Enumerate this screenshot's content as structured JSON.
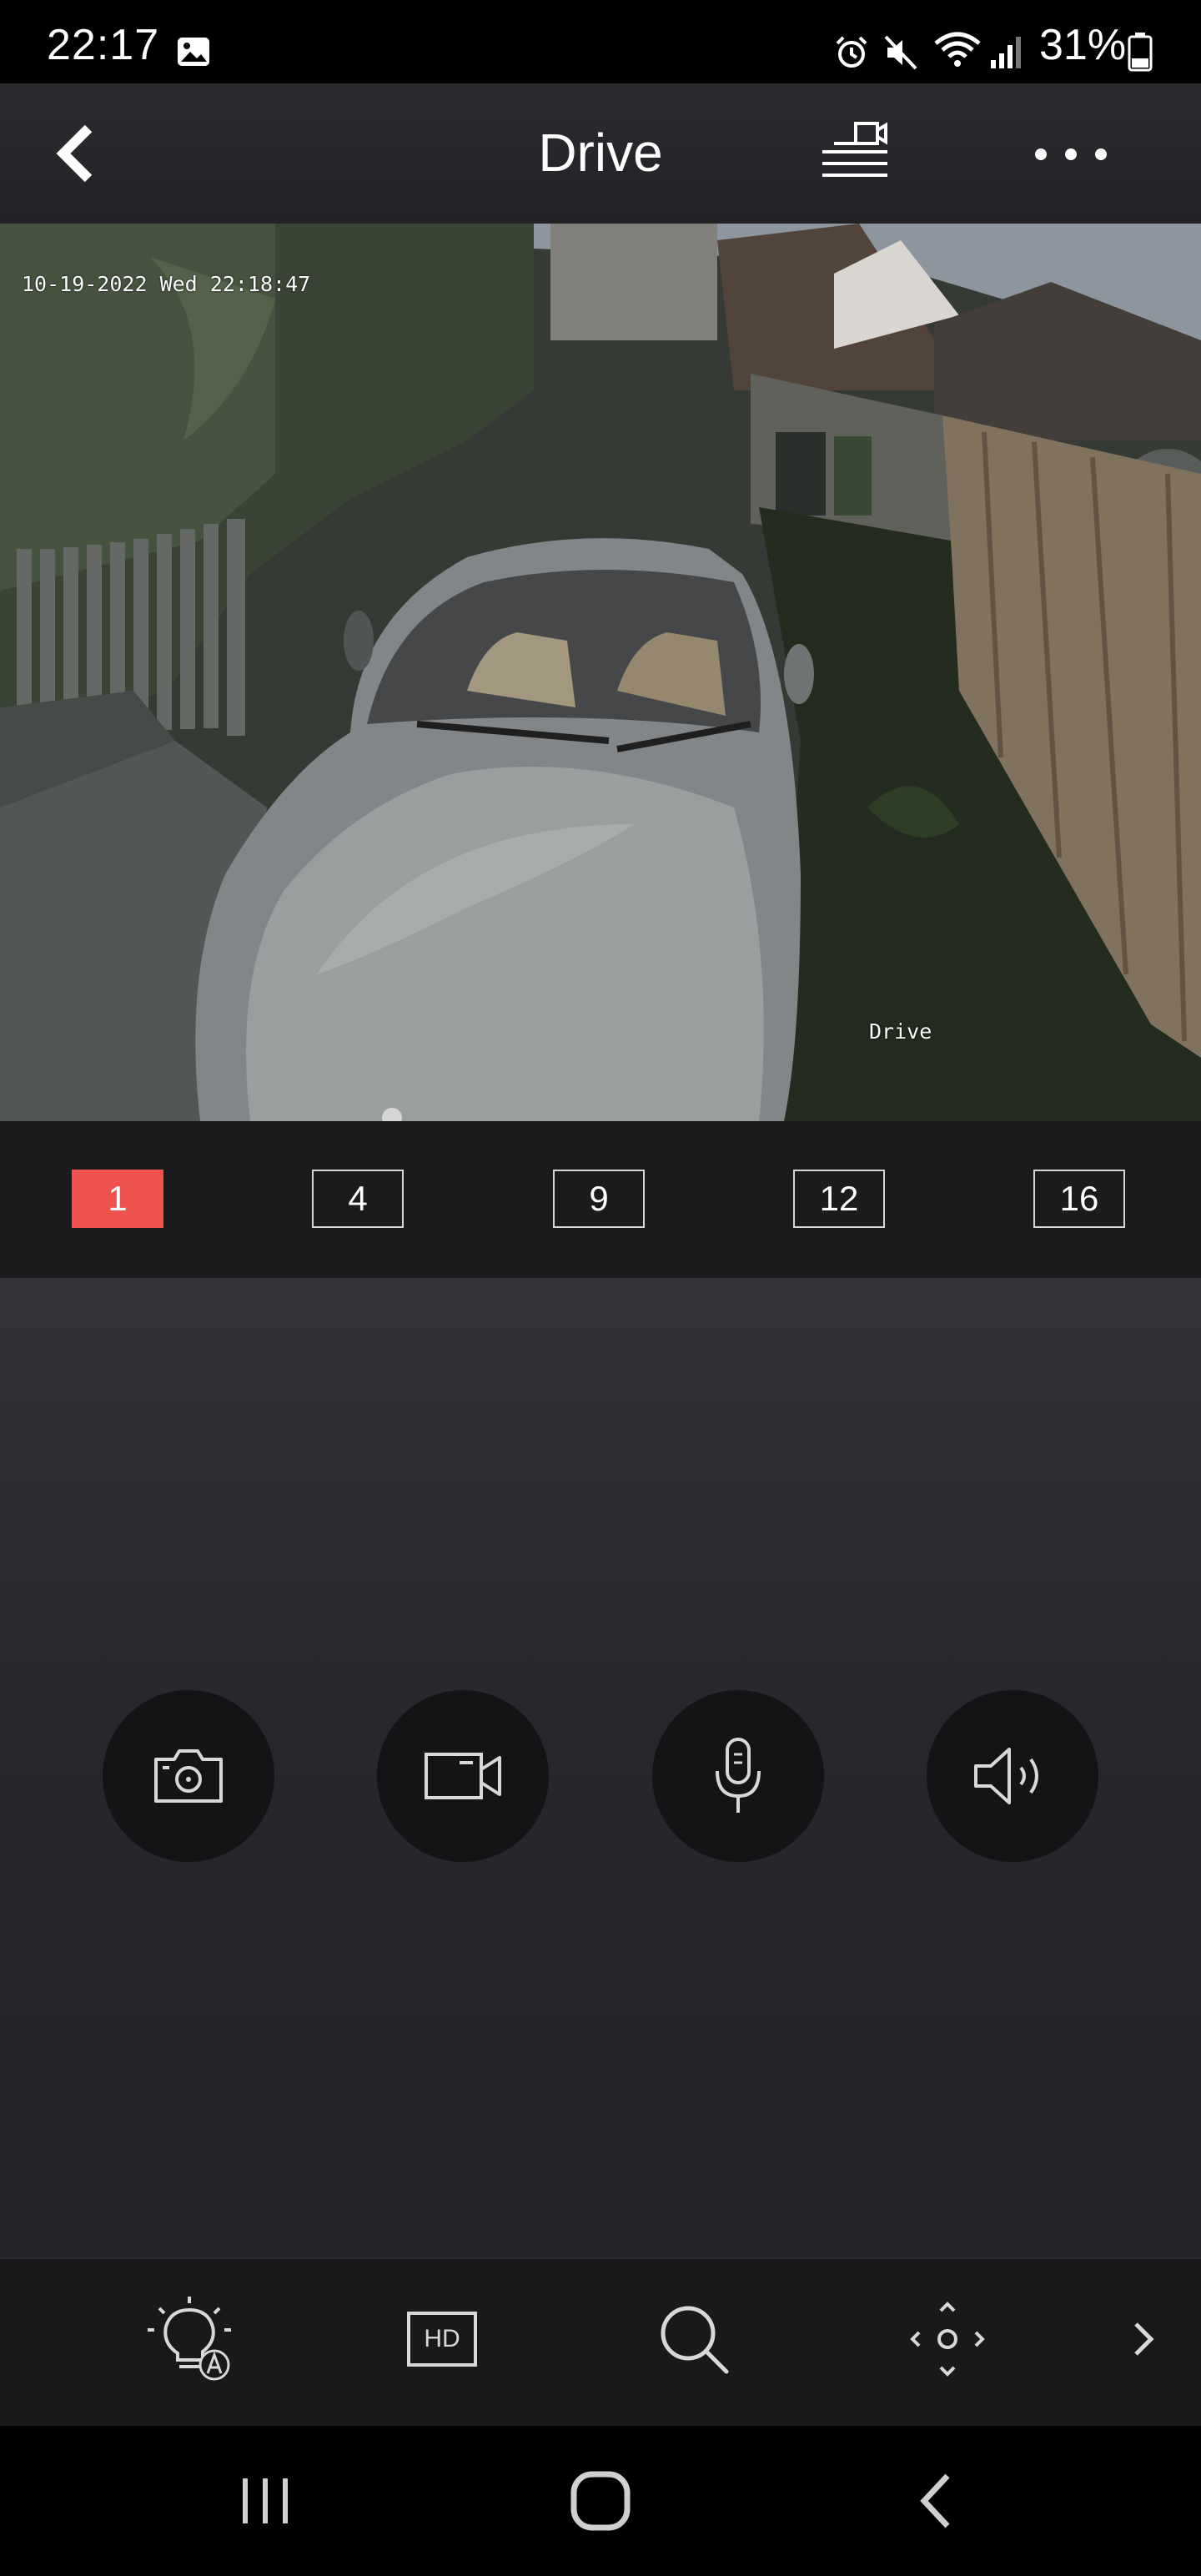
{
  "status_bar": {
    "time": "22:17",
    "battery": "31%",
    "icons": [
      "gallery-icon",
      "alarm-icon",
      "mute-icon",
      "wifi-icon",
      "signal-icon",
      "battery-icon"
    ]
  },
  "header": {
    "title": "Drive",
    "back_icon": "chevron-left-icon",
    "layout_icon": "device-list-icon",
    "more_icon": "more-dots-icon"
  },
  "video": {
    "osd_timestamp": "10-19-2022 Wed 22:18:47",
    "osd_channel_name": "Drive"
  },
  "layout_options": {
    "items": [
      {
        "label": "1",
        "active": true
      },
      {
        "label": "4",
        "active": false
      },
      {
        "label": "9",
        "active": false
      },
      {
        "label": "12",
        "active": false
      },
      {
        "label": "16",
        "active": false
      }
    ],
    "active_color": "#ef5350"
  },
  "controls": [
    "snapshot-camera-icon",
    "record-video-icon",
    "microphone-icon",
    "speaker-icon"
  ],
  "toolbar": [
    "light-auto-icon",
    "hd-quality-icon",
    "zoom-search-icon",
    "ptz-direction-icon",
    "next-chevron-icon"
  ],
  "toolbar_hd_label": "HD",
  "nav_bar": [
    "recent-apps-icon",
    "home-icon",
    "back-icon"
  ]
}
